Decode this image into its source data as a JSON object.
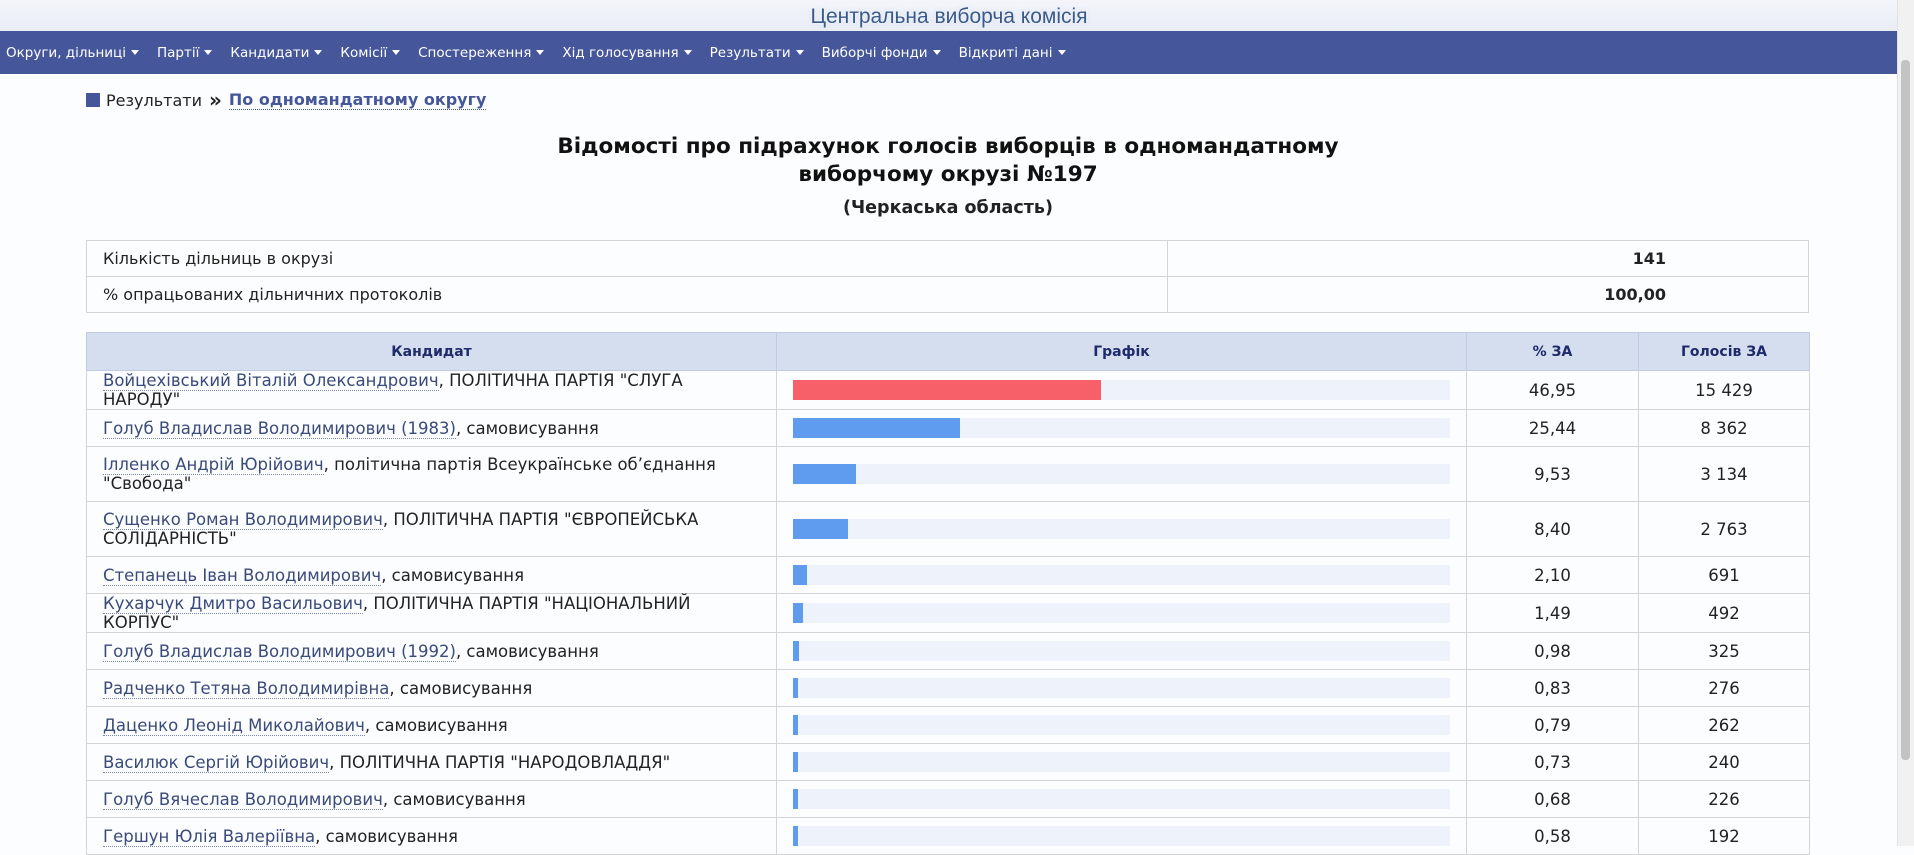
{
  "header": {
    "site_title": "Центральна виборча комісія"
  },
  "nav": [
    "Округи, дільниці",
    "Партії",
    "Кандидати",
    "Комісії",
    "Спостереження",
    "Хід голосування",
    "Результати",
    "Виборчі фонди",
    "Відкриті дані"
  ],
  "breadcrumb": {
    "root": "Результати",
    "separator": "»",
    "current": "По одномандатному округу"
  },
  "page": {
    "title_line1": "Відомості про підрахунок голосів виборців в одномандатному",
    "title_line2": "виборчому окрузі №197",
    "subtitle": "(Черкаська область)"
  },
  "summary": [
    {
      "label": "Кількість дільниць в окрузі",
      "value": "141"
    },
    {
      "label": "% опрацьованих дільничних протоколів",
      "value": "100,00"
    }
  ],
  "results": {
    "headers": {
      "candidate": "Кандидат",
      "chart": "Графік",
      "percent": "% ЗА",
      "votes": "Голосів ЗА"
    },
    "colors": {
      "leader": "#f76068",
      "other": "#5f9cf0",
      "track": "#eef2fa"
    },
    "rows": [
      {
        "name": "Войцехівський Віталій Олександрович",
        "party": ", ПОЛІТИЧНА ПАРТІЯ \"СЛУГА НАРОДУ\"",
        "percent_text": "46,95",
        "percent": 46.95,
        "votes": "15 429"
      },
      {
        "name": "Голуб Владислав Володимирович (1983)",
        "party": ", самовисування",
        "percent_text": "25,44",
        "percent": 25.44,
        "votes": "8 362"
      },
      {
        "name": "Ілленко Андрій Юрійович",
        "party": ", політична партія Всеукраїнське об’єднання \"Свобода\"",
        "percent_text": "9,53",
        "percent": 9.53,
        "votes": "3 134"
      },
      {
        "name": "Сущенко Роман Володимирович",
        "party": ", ПОЛІТИЧНА ПАРТІЯ \"ЄВРОПЕЙСЬКА СОЛІДАРНІСТЬ\"",
        "percent_text": "8,40",
        "percent": 8.4,
        "votes": "2 763"
      },
      {
        "name": "Степанець Іван Володимирович",
        "party": ", самовисування",
        "percent_text": "2,10",
        "percent": 2.1,
        "votes": "691"
      },
      {
        "name": "Кухарчук Дмитро Васильович",
        "party": ", ПОЛІТИЧНА ПАРТІЯ \"НАЦІОНАЛЬНИЙ КОРПУС\"",
        "percent_text": "1,49",
        "percent": 1.49,
        "votes": "492"
      },
      {
        "name": "Голуб Владислав Володимирович (1992)",
        "party": ", самовисування",
        "percent_text": "0,98",
        "percent": 0.98,
        "votes": "325"
      },
      {
        "name": "Радченко Тетяна Володимирівна",
        "party": ", самовисування",
        "percent_text": "0,83",
        "percent": 0.83,
        "votes": "276"
      },
      {
        "name": "Даценко Леонід Миколайович",
        "party": ", самовисування",
        "percent_text": "0,79",
        "percent": 0.79,
        "votes": "262"
      },
      {
        "name": "Василюк Сергій Юрійович",
        "party": ", ПОЛІТИЧНА ПАРТІЯ \"НАРОДОВЛАДДЯ\"",
        "percent_text": "0,73",
        "percent": 0.73,
        "votes": "240"
      },
      {
        "name": "Голуб Вячеслав Володимирович",
        "party": ", самовисування",
        "percent_text": "0,68",
        "percent": 0.68,
        "votes": "226"
      },
      {
        "name": "Гершун Юлія Валеріївна",
        "party": ", самовисування",
        "percent_text": "0,58",
        "percent": 0.58,
        "votes": "192"
      }
    ]
  }
}
